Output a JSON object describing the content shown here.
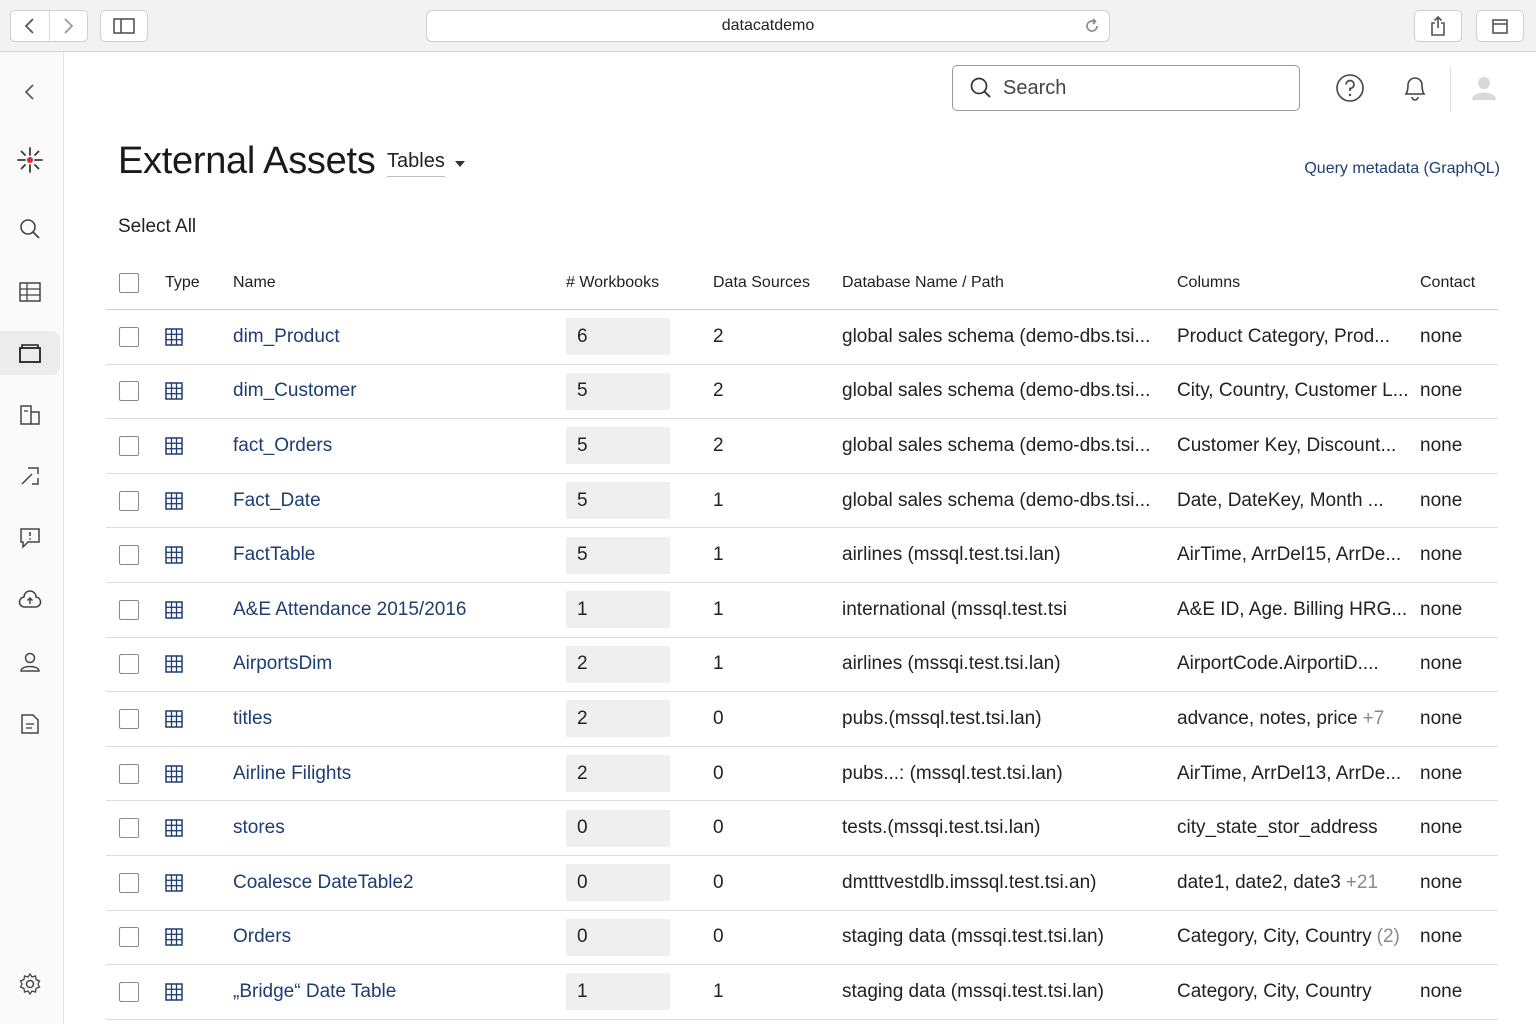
{
  "browser": {
    "url": "datacatdemo"
  },
  "header": {
    "search_placeholder": "Search",
    "title": "External Assets",
    "scope_label": "Tables",
    "graphql_link": "Query metadata (GraphQL)",
    "select_all": "Select All"
  },
  "table": {
    "columns": {
      "type": "Type",
      "name": "Name",
      "workbooks": "# Workbooks",
      "data_sources": "Data Sources",
      "database": "Database Name / Path",
      "columns": "Columns",
      "contact": "Contact"
    },
    "rows": [
      {
        "name": "dim_Product",
        "workbooks": "6",
        "data_sources": "2",
        "database": "global sales schema (demo-dbs.tsi...",
        "columns": "Product Category, Prod...",
        "columns_extra": "",
        "contact": "none"
      },
      {
        "name": "dim_Customer",
        "workbooks": "5",
        "data_sources": "2",
        "database": "global sales schema (demo-dbs.tsi...",
        "columns": "City, Country, Customer L...",
        "columns_extra": "",
        "contact": "none"
      },
      {
        "name": "fact_Orders",
        "workbooks": "5",
        "data_sources": "2",
        "database": "global sales schema (demo-dbs.tsi...",
        "columns": "Customer Key, Discount...",
        "columns_extra": "",
        "contact": "none"
      },
      {
        "name": "Fact_Date",
        "workbooks": "5",
        "data_sources": "1",
        "database": "global sales schema (demo-dbs.tsi...",
        "columns": "Date, DateKey, Month ...",
        "columns_extra": "",
        "contact": "none"
      },
      {
        "name": "FactTable",
        "workbooks": "5",
        "data_sources": "1",
        "database": "airlines (mssql.test.tsi.lan)",
        "columns": "AirTime, ArrDel15, ArrDe...",
        "columns_extra": "",
        "contact": "none"
      },
      {
        "name": "A&E Attendance 2015/2016",
        "workbooks": "1",
        "data_sources": "1",
        "database": "international (mssql.test.tsi",
        "columns": "A&E ID, Age. Billing HRG...",
        "columns_extra": "",
        "contact": "none"
      },
      {
        "name": "AirportsDim",
        "workbooks": "2",
        "data_sources": "1",
        "database": "airlines (mssqi.test.tsi.lan)",
        "columns": "AirportCode.AirportiD....",
        "columns_extra": "",
        "contact": "none"
      },
      {
        "name": "titles",
        "workbooks": "2",
        "data_sources": "0",
        "database": "pubs.(mssql.test.tsi.lan)",
        "columns": "advance, notes, price",
        "columns_extra": "+7",
        "contact": "none"
      },
      {
        "name": "Airline Filights",
        "workbooks": "2",
        "data_sources": "0",
        "database": "pubs...: (mssql.test.tsi.lan)",
        "columns": "AirTime, ArrDel13, ArrDe...",
        "columns_extra": "",
        "contact": "none"
      },
      {
        "name": "stores",
        "workbooks": "0",
        "data_sources": "0",
        "database": "tests.(mssqi.test.tsi.lan)",
        "columns": "city_state_stor_address",
        "columns_extra": "",
        "contact": "none"
      },
      {
        "name": "Coalesce DateTable2",
        "workbooks": "0",
        "data_sources": "0",
        "database": "dmtttvestdlb.imssql.test.tsi.an)",
        "columns": "date1, date2, date3",
        "columns_extra": "+21",
        "contact": "none"
      },
      {
        "name": "Orders",
        "workbooks": "0",
        "data_sources": "0",
        "database": "staging data (mssqi.test.tsi.lan)",
        "columns": "Category, City, Country",
        "columns_extra": "(2)",
        "contact": "none"
      },
      {
        "name": "„Bridge“ Date Table",
        "workbooks": "1",
        "data_sources": "1",
        "database": "staging data (mssqi.test.tsi.lan)",
        "columns": "Category, City, Country",
        "columns_extra": "",
        "contact": "none"
      }
    ]
  },
  "icons": {
    "rail": [
      "collapse-icon",
      "logo-icon",
      "search-icon",
      "tables-icon",
      "external-assets-icon",
      "data-sources-icon",
      "lineage-icon",
      "feedback-icon",
      "upload-icon",
      "user-icon",
      "documents-icon",
      "settings-icon"
    ],
    "row_type": "table-icon"
  },
  "colors": {
    "link": "#1d3d73",
    "accent": "#e8262b"
  }
}
